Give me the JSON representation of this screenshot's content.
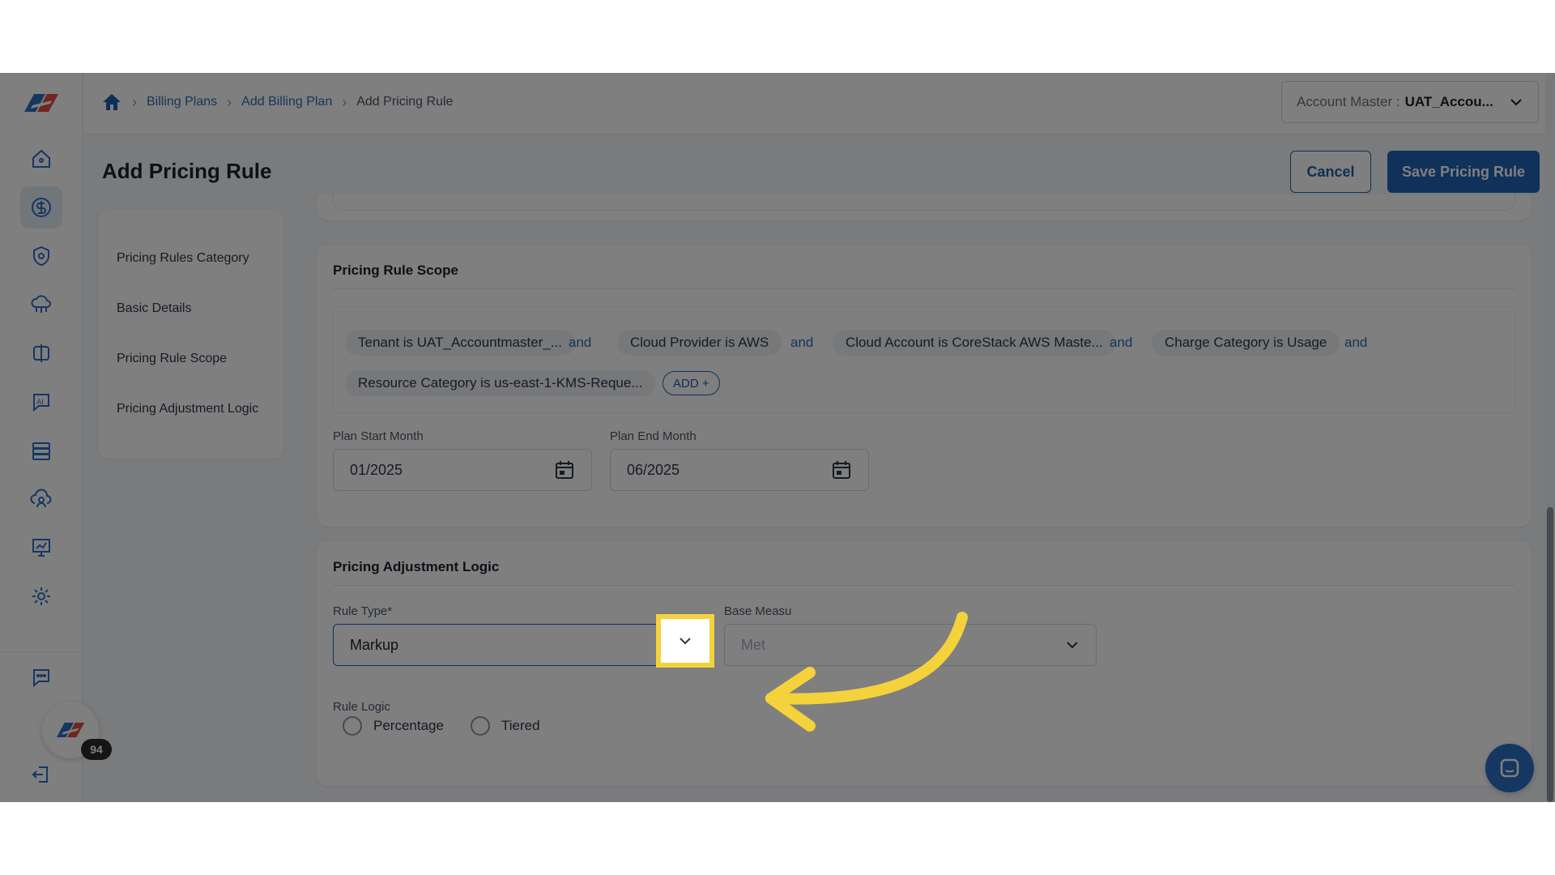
{
  "breadcrumb": {
    "items": [
      "Billing Plans",
      "Add Billing Plan"
    ],
    "current": "Add Pricing Rule"
  },
  "account": {
    "label": "Account Master :",
    "value": "UAT_Accou..."
  },
  "page": {
    "title": "Add Pricing Rule",
    "cancel_label": "Cancel",
    "save_label": "Save Pricing Rule"
  },
  "section_nav": {
    "items": [
      "Pricing Rules Category",
      "Basic Details",
      "Pricing Rule Scope",
      "Pricing Adjustment Logic"
    ]
  },
  "scope": {
    "title": "Pricing Rule Scope",
    "chips": [
      "Tenant is UAT_Accountmaster_...",
      "Cloud Provider is AWS",
      "Cloud Account is CoreStack AWS Maste...",
      "Charge Category is Usage",
      "Resource Category is us-east-1-KMS-Reque..."
    ],
    "conjunction": "and",
    "add_label": "ADD +",
    "start_label": "Plan Start Month",
    "start_value": "01/2025",
    "end_label": "Plan End Month",
    "end_value": "06/2025"
  },
  "logic": {
    "title": "Pricing Adjustment Logic",
    "rule_type_label": "Rule Type*",
    "rule_type_value": "Markup",
    "base_measure_label": "Base Measu",
    "base_measure_placeholder": "Met",
    "rule_logic_label": "Rule Logic",
    "radio_options": [
      "Percentage",
      "Tiered"
    ]
  },
  "chat": {
    "badge_count": "94"
  },
  "colors": {
    "primary": "#1f63b5",
    "link": "#2b6cb0",
    "highlight": "#f4d23b"
  },
  "icons": [
    "home-icon",
    "dollar-icon",
    "shield-icon",
    "cloud-network-icon",
    "compare-icon",
    "ai-chat-icon",
    "server-icon",
    "cloud-user-icon",
    "presentation-chart-icon",
    "settings-icon",
    "chat-settings-icon",
    "logout-icon",
    "calendar-icon",
    "chevron-down-icon"
  ]
}
